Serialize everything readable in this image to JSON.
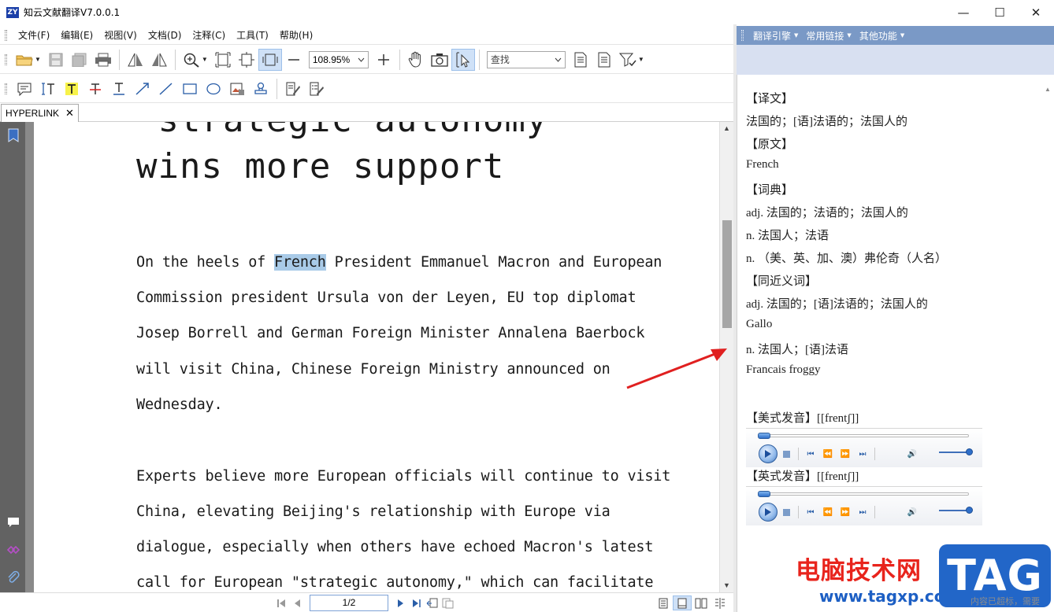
{
  "window": {
    "logo_text": "ZY",
    "title": "知云文献翻译V7.0.0.1",
    "controls": {
      "minimize": "—",
      "maximize": "☐",
      "close": "✕"
    }
  },
  "menubar": {
    "items": [
      "文件(F)",
      "编辑(E)",
      "视图(V)",
      "文档(D)",
      "注释(C)",
      "工具(T)",
      "帮助(H)"
    ]
  },
  "toolbar": {
    "zoom_value": "108.95%",
    "search_placeholder": "查找"
  },
  "tab": {
    "label": "HYPERLINK",
    "close": "✕"
  },
  "document": {
    "heading_lines": [
      "\"strategic autonomy\"",
      "wins more support"
    ],
    "paragraph1": {
      "line1_before": "On the heels of ",
      "line1_highlight": "French",
      "line1_after": " President Emmanuel Macron and European",
      "line2": "Commission president Ursula von der Leyen, EU top diplomat",
      "line3": "Josep Borrell and German Foreign Minister Annalena Baerbock",
      "line4": "will visit China, Chinese Foreign Ministry announced on",
      "line5": "Wednesday."
    },
    "paragraph2": [
      "Experts believe more European officials will continue to visit",
      "China, elevating Beijing's relationship with Europe via",
      "dialogue, especially when others have echoed Macron's latest",
      "call for European \"strategic autonomy,\" which can facilitate"
    ]
  },
  "statusbar": {
    "page_value": "1/2"
  },
  "translation_panel": {
    "menu": [
      "翻译引擎",
      "常用链接",
      "其他功能"
    ],
    "lines": [
      "【译文】",
      "法国的；[语]法语的；法国人的",
      "【原文】",
      "French",
      "【词典】",
      "adj. 法国的；法语的；法国人的",
      "n. 法国人；法语",
      "n. （美、英、加、澳）弗伦奇（人名）",
      "【同近义词】",
      "adj. 法国的；[语]法语的；法国人的",
      "Gallo",
      "n. 法国人；[语]法语",
      "Francais  froggy"
    ],
    "us_pron": "【美式发音】[[frentʃ]]",
    "uk_pron": "【英式发音】[[frentʃ]]"
  },
  "watermark": {
    "site_name": "电脑技术网",
    "url": "www.tagxp.com",
    "badge": "TAG",
    "note": "内容已超标，需要"
  }
}
